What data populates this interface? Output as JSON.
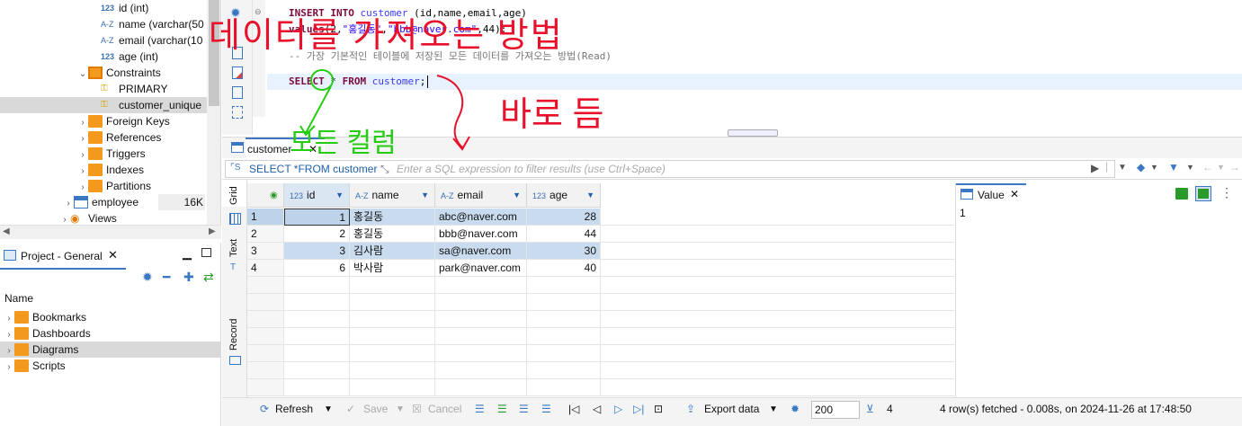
{
  "db_tree": {
    "items": [
      {
        "label": "id (int)",
        "icon": "number-column-icon",
        "level": 4
      },
      {
        "label": "name (varchar(50",
        "icon": "text-column-icon",
        "level": 4
      },
      {
        "label": "email (varchar(10",
        "icon": "text-column-icon",
        "level": 4
      },
      {
        "label": "age (int)",
        "icon": "number-column-icon",
        "level": 4
      },
      {
        "label": "Constraints",
        "icon": "folder-icon",
        "level": 3,
        "expanded": true
      },
      {
        "label": "PRIMARY",
        "icon": "key-icon",
        "level": 4
      },
      {
        "label": "customer_unique",
        "icon": "key-icon",
        "level": 4,
        "selected": true
      },
      {
        "label": "Foreign Keys",
        "icon": "folder-icon",
        "level": 3
      },
      {
        "label": "References",
        "icon": "folder-icon",
        "level": 3
      },
      {
        "label": "Triggers",
        "icon": "folder-icon",
        "level": 3
      },
      {
        "label": "Indexes",
        "icon": "folder-icon",
        "level": 3
      },
      {
        "label": "Partitions",
        "icon": "folder-icon",
        "level": 3
      },
      {
        "label": "employee",
        "icon": "table-icon",
        "level": 2,
        "size": "16K"
      },
      {
        "label": "Views",
        "icon": "views-icon",
        "level": 1
      }
    ]
  },
  "project_panel": {
    "tab_label": "Project - General",
    "column_header": "Name",
    "items": [
      {
        "label": "Bookmarks",
        "icon": "bookmarks-folder-icon"
      },
      {
        "label": "Dashboards",
        "icon": "dashboards-folder-icon"
      },
      {
        "label": "Diagrams",
        "icon": "diagrams-folder-icon",
        "selected": true
      },
      {
        "label": "Scripts",
        "icon": "scripts-folder-icon"
      }
    ]
  },
  "editor": {
    "lines": [
      {
        "parts": [
          [
            "kw",
            "INSERT INTO "
          ],
          [
            "tbl",
            "customer"
          ],
          [
            "plain",
            " (id,name,email,age)"
          ]
        ]
      },
      {
        "parts": [
          [
            "kw",
            "values"
          ],
          [
            "plain",
            "(2,"
          ],
          [
            "str",
            "\"홍길동\""
          ],
          [
            "plain",
            ","
          ],
          [
            "str",
            "\"bbb@naver.com\""
          ],
          [
            "plain",
            ",44);"
          ]
        ]
      },
      {
        "parts": [
          [
            "cmt",
            ""
          ]
        ]
      },
      {
        "parts": [
          [
            "cmt",
            "-- 가장 기본적인 테이블에 저장된 모든 데이터를 가져오는 방법(Read)"
          ]
        ]
      },
      {
        "parts": [
          [
            "cmt",
            ""
          ]
        ]
      },
      {
        "parts": [
          [
            "kw",
            "SELECT "
          ],
          [
            "plain",
            "* "
          ],
          [
            "kw",
            "FROM "
          ],
          [
            "tbl",
            "customer"
          ],
          [
            "plain",
            ";"
          ]
        ]
      }
    ]
  },
  "results": {
    "tab_label": "customer",
    "filter_query": "SELECT *FROM customer",
    "filter_placeholder": "Enter a SQL expression to filter results (use Ctrl+Space)",
    "side_tabs": {
      "grid": "Grid",
      "text": "Text",
      "record": "Record"
    },
    "columns": [
      {
        "name": "id",
        "type_icon": "123"
      },
      {
        "name": "name",
        "type_icon": "A-Z"
      },
      {
        "name": "email",
        "type_icon": "A-Z"
      },
      {
        "name": "age",
        "type_icon": "123"
      }
    ],
    "rows": [
      {
        "n": "1",
        "id": "1",
        "name": "홍길동",
        "email": "abc@naver.com",
        "age": "28"
      },
      {
        "n": "2",
        "id": "2",
        "name": "홍길동",
        "email": "bbb@naver.com",
        "age": "44"
      },
      {
        "n": "3",
        "id": "3",
        "name": "김사람",
        "email": "sa@naver.com",
        "age": "30"
      },
      {
        "n": "4",
        "id": "6",
        "name": "박사람",
        "email": "park@naver.com",
        "age": "40"
      }
    ],
    "value_panel": {
      "tab_label": "Value",
      "content": "1"
    }
  },
  "status_bar": {
    "refresh": "Refresh",
    "save": "Save",
    "cancel": "Cancel",
    "export": "Export data",
    "rows_limit": "200",
    "row_count": "4",
    "status_text": "4 row(s) fetched - 0.008s, on 2024-11-26 at 17:48:50"
  },
  "annotations": {
    "red_top": "데이터를 가져오는 방법",
    "red_right": "바로 듬",
    "green": "모든 컬럼"
  },
  "colors": {
    "accent": "#3a78c3",
    "folder": "#f39a1e",
    "selection": "#c9dbef",
    "annotation_red": "#e8102a",
    "annotation_green": "#24cc12"
  }
}
